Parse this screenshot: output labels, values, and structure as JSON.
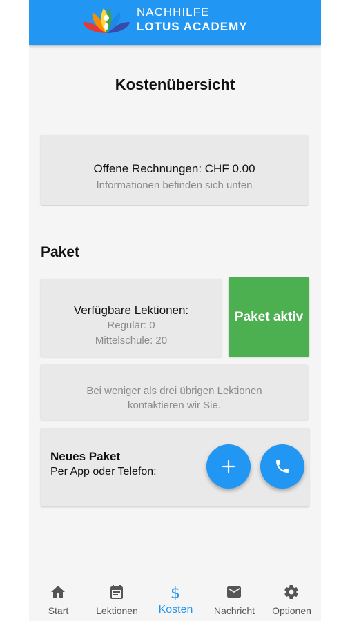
{
  "header": {
    "brand_top": "NACHHILFE",
    "brand_bottom": "LOTUS ACADEMY",
    "colors": {
      "primary": "#2196f3"
    }
  },
  "page": {
    "title": "Kostenübersicht"
  },
  "invoice": {
    "text": "Offene Rechnungen: CHF 0.00",
    "hint": "Informationen befinden sich unten"
  },
  "package": {
    "section_title": "Paket",
    "available_title": "Verfügbare Lektionen:",
    "regular": "Regulär: 0",
    "middle_school": "Mittelschule: 20",
    "status": "Paket aktiv",
    "status_color": "#4caf50",
    "notice": "Bei weniger als drei übrigen Lektionen kontaktieren wir Sie."
  },
  "new_package": {
    "title": "Neues Paket",
    "subtitle": "Per App oder Telefon:",
    "add_icon": "plus-icon",
    "call_icon": "phone-icon"
  },
  "nav": {
    "items": [
      {
        "label": "Start",
        "icon": "home-icon"
      },
      {
        "label": "Lektionen",
        "icon": "calendar-icon"
      },
      {
        "label": "Kosten",
        "icon": "dollar-icon",
        "active": true
      },
      {
        "label": "Nachricht",
        "icon": "mail-icon"
      },
      {
        "label": "Optionen",
        "icon": "gear-icon"
      }
    ]
  }
}
